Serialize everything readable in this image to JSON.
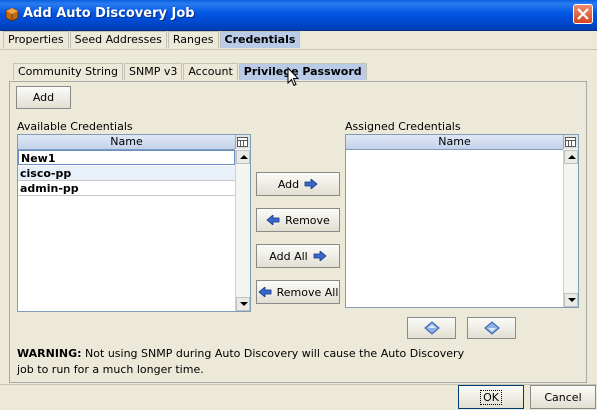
{
  "window": {
    "title": "Add Auto Discovery Job"
  },
  "top_tabs": [
    {
      "label": "Properties",
      "active": false
    },
    {
      "label": "Seed Addresses",
      "active": false
    },
    {
      "label": "Ranges",
      "active": false
    },
    {
      "label": "Credentials",
      "active": true
    }
  ],
  "sub_tabs": [
    {
      "label": "Community String",
      "active": false
    },
    {
      "label": "SNMP v3",
      "active": false
    },
    {
      "label": "Account",
      "active": false
    },
    {
      "label": "Privilege Password",
      "active": true
    }
  ],
  "add_button": "Add",
  "available": {
    "label": "Available Credentials",
    "column": "Name",
    "items": [
      "New1",
      "cisco-pp",
      "admin-pp"
    ]
  },
  "assigned": {
    "label": "Assigned Credentials",
    "column": "Name",
    "items": []
  },
  "transfer": {
    "add": "Add",
    "remove": "Remove",
    "add_all": "Add All",
    "remove_all": "Remove All"
  },
  "warning": {
    "prefix": "WARNING:",
    "text": " Not using SNMP during Auto Discovery will cause the Auto Discovery job to run for a much longer time."
  },
  "footer": {
    "ok": "OK",
    "cancel": "Cancel"
  },
  "colors": {
    "titlebar": "#0055e5",
    "active_tab": "#b9cbe7",
    "list_border": "#7f9db9"
  }
}
